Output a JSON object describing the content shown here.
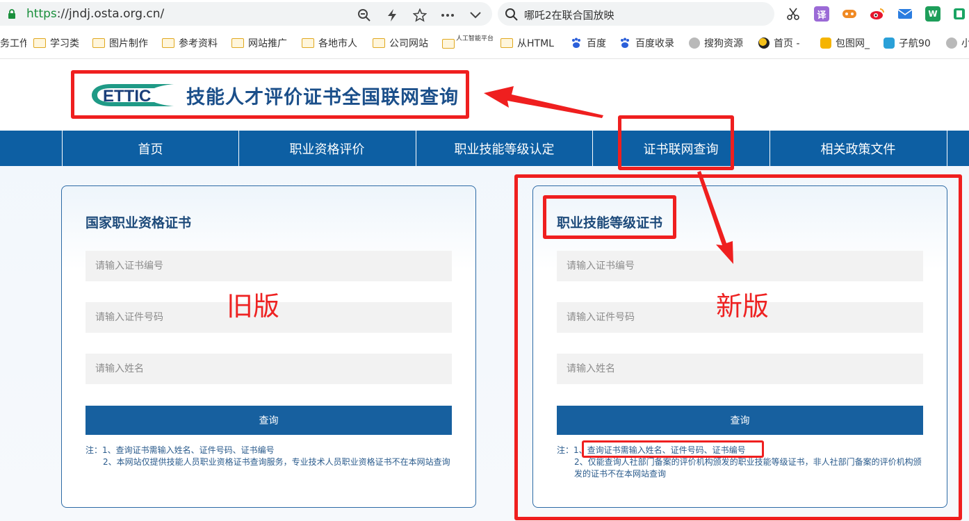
{
  "browser": {
    "url_scheme": "https",
    "url_rest": "://jndj.osta.org.cn/",
    "search_text": "哪吒2在联合国放映",
    "icons": [
      "lock-icon",
      "zoom-out-icon",
      "lightning-icon",
      "star-icon",
      "more-icon",
      "chevron-down-icon",
      "search-icon",
      "scissors-icon",
      "translate-icon",
      "game-icon",
      "weibo-icon",
      "mail-icon",
      "word-icon",
      "book-icon"
    ],
    "ext_translate_label": "译",
    "ext_word_label": "W",
    "bookmarks": [
      {
        "label": "务工作",
        "icon": "folder"
      },
      {
        "label": "学习类",
        "icon": "folder"
      },
      {
        "label": "图片制作",
        "icon": "folder"
      },
      {
        "label": "参考资料",
        "icon": "folder"
      },
      {
        "label": "网站推广",
        "icon": "folder"
      },
      {
        "label": "各地市人",
        "icon": "folder"
      },
      {
        "label": "公司网站",
        "icon": "folder"
      },
      {
        "label": "人工智能平台",
        "icon": "folder"
      },
      {
        "label": "从HTML",
        "icon": "folder"
      },
      {
        "label": "百度",
        "icon": "paw"
      },
      {
        "label": "百度收录",
        "icon": "paw"
      },
      {
        "label": "搜狗资源",
        "icon": "globe"
      },
      {
        "label": "首页 -",
        "icon": "site"
      },
      {
        "label": "包图网_",
        "icon": "site"
      },
      {
        "label": "子航90",
        "icon": "robot"
      },
      {
        "label": "小",
        "icon": "globe"
      }
    ]
  },
  "site": {
    "logo_text": "ETTIC",
    "title": "技能人才评价证书全国联网查询",
    "nav": [
      "首页",
      "职业资格评价",
      "职业技能等级认定",
      "证书联网查询",
      "相关政策文件"
    ]
  },
  "cards": {
    "left": {
      "title": "国家职业资格证书",
      "cert_no_placeholder": "请输入证书编号",
      "id_no_placeholder": "请输入证件号码",
      "name_placeholder": "请输入姓名",
      "button": "查询",
      "note_prefix": "注：",
      "note_1": "1、查询证书需输入姓名、证件号码、证书编号",
      "note_2": "2、本网站仅提供技能人员职业资格证书查询服务，专业技术人员职业资格证书不在本网站查询"
    },
    "right": {
      "title": "职业技能等级证书",
      "cert_no_placeholder": "请输入证书编号",
      "id_no_placeholder": "请输入证件号码",
      "name_placeholder": "请输入姓名",
      "button": "查询",
      "note_prefix": "注：",
      "note_1_num": "1、",
      "note_1": "查询证书需输入姓名、证件号码、证书编号",
      "note_2": "2、仅能查询人社部门备案的评价机构颁发的职业技能等级证书，非人社部门备案的评价机构颁发的证书不在本网站查询"
    }
  },
  "annotations": {
    "old_label": "旧版",
    "new_label": "新版",
    "color": "#ef1f1f"
  },
  "colors": {
    "nav_bg": "#0d5fa3",
    "button_bg": "#17609f",
    "title_blue": "#1b4f8a",
    "secure_green": "#1a8f3c"
  }
}
